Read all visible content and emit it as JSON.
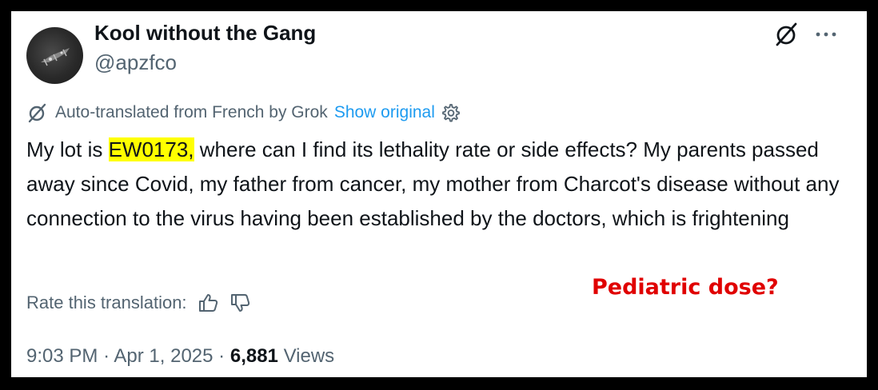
{
  "post": {
    "author_name": "Kool without the Gang",
    "author_handle": "@apzfco",
    "translation_note": "Auto-translated from French by Grok",
    "show_original_label": "Show original",
    "text_pre": "My lot is ",
    "text_highlight": "EW0173,",
    "text_post": " where can I find its lethality rate or side effects? My parents passed away since Covid, my father from cancer, my mother from Charcot's disease without any connection to the virus having been established by the doctors, which is frightening",
    "rate_label": "Rate this translation:",
    "time": "9:03 PM",
    "separator": "·",
    "date": "Apr 1, 2025",
    "views_count": "6,881",
    "views_label": "Views"
  },
  "annotation": {
    "text": "Pediatric dose?",
    "color": "#e00000"
  },
  "colors": {
    "highlight": "#ffff00",
    "link": "#1d9bf0",
    "secondary_text": "#536471",
    "primary_text": "#0f1419"
  },
  "icons": [
    "grok-icon",
    "more-icon",
    "gear-icon",
    "thumbs-up-icon",
    "thumbs-down-icon"
  ]
}
